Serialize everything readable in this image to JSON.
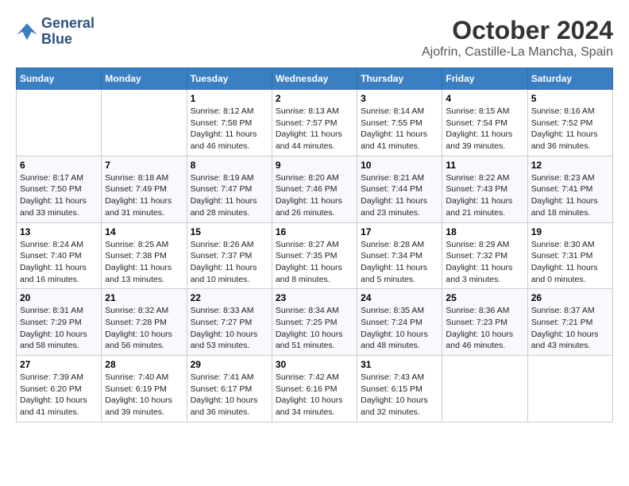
{
  "logo": {
    "line1": "General",
    "line2": "Blue"
  },
  "title": "October 2024",
  "location": "Ajofrin, Castille-La Mancha, Spain",
  "days_of_week": [
    "Sunday",
    "Monday",
    "Tuesday",
    "Wednesday",
    "Thursday",
    "Friday",
    "Saturday"
  ],
  "weeks": [
    [
      {
        "day": "",
        "info": ""
      },
      {
        "day": "",
        "info": ""
      },
      {
        "day": "1",
        "info": "Sunrise: 8:12 AM\nSunset: 7:58 PM\nDaylight: 11 hours and 46 minutes."
      },
      {
        "day": "2",
        "info": "Sunrise: 8:13 AM\nSunset: 7:57 PM\nDaylight: 11 hours and 44 minutes."
      },
      {
        "day": "3",
        "info": "Sunrise: 8:14 AM\nSunset: 7:55 PM\nDaylight: 11 hours and 41 minutes."
      },
      {
        "day": "4",
        "info": "Sunrise: 8:15 AM\nSunset: 7:54 PM\nDaylight: 11 hours and 39 minutes."
      },
      {
        "day": "5",
        "info": "Sunrise: 8:16 AM\nSunset: 7:52 PM\nDaylight: 11 hours and 36 minutes."
      }
    ],
    [
      {
        "day": "6",
        "info": "Sunrise: 8:17 AM\nSunset: 7:50 PM\nDaylight: 11 hours and 33 minutes."
      },
      {
        "day": "7",
        "info": "Sunrise: 8:18 AM\nSunset: 7:49 PM\nDaylight: 11 hours and 31 minutes."
      },
      {
        "day": "8",
        "info": "Sunrise: 8:19 AM\nSunset: 7:47 PM\nDaylight: 11 hours and 28 minutes."
      },
      {
        "day": "9",
        "info": "Sunrise: 8:20 AM\nSunset: 7:46 PM\nDaylight: 11 hours and 26 minutes."
      },
      {
        "day": "10",
        "info": "Sunrise: 8:21 AM\nSunset: 7:44 PM\nDaylight: 11 hours and 23 minutes."
      },
      {
        "day": "11",
        "info": "Sunrise: 8:22 AM\nSunset: 7:43 PM\nDaylight: 11 hours and 21 minutes."
      },
      {
        "day": "12",
        "info": "Sunrise: 8:23 AM\nSunset: 7:41 PM\nDaylight: 11 hours and 18 minutes."
      }
    ],
    [
      {
        "day": "13",
        "info": "Sunrise: 8:24 AM\nSunset: 7:40 PM\nDaylight: 11 hours and 16 minutes."
      },
      {
        "day": "14",
        "info": "Sunrise: 8:25 AM\nSunset: 7:38 PM\nDaylight: 11 hours and 13 minutes."
      },
      {
        "day": "15",
        "info": "Sunrise: 8:26 AM\nSunset: 7:37 PM\nDaylight: 11 hours and 10 minutes."
      },
      {
        "day": "16",
        "info": "Sunrise: 8:27 AM\nSunset: 7:35 PM\nDaylight: 11 hours and 8 minutes."
      },
      {
        "day": "17",
        "info": "Sunrise: 8:28 AM\nSunset: 7:34 PM\nDaylight: 11 hours and 5 minutes."
      },
      {
        "day": "18",
        "info": "Sunrise: 8:29 AM\nSunset: 7:32 PM\nDaylight: 11 hours and 3 minutes."
      },
      {
        "day": "19",
        "info": "Sunrise: 8:30 AM\nSunset: 7:31 PM\nDaylight: 11 hours and 0 minutes."
      }
    ],
    [
      {
        "day": "20",
        "info": "Sunrise: 8:31 AM\nSunset: 7:29 PM\nDaylight: 10 hours and 58 minutes."
      },
      {
        "day": "21",
        "info": "Sunrise: 8:32 AM\nSunset: 7:28 PM\nDaylight: 10 hours and 56 minutes."
      },
      {
        "day": "22",
        "info": "Sunrise: 8:33 AM\nSunset: 7:27 PM\nDaylight: 10 hours and 53 minutes."
      },
      {
        "day": "23",
        "info": "Sunrise: 8:34 AM\nSunset: 7:25 PM\nDaylight: 10 hours and 51 minutes."
      },
      {
        "day": "24",
        "info": "Sunrise: 8:35 AM\nSunset: 7:24 PM\nDaylight: 10 hours and 48 minutes."
      },
      {
        "day": "25",
        "info": "Sunrise: 8:36 AM\nSunset: 7:23 PM\nDaylight: 10 hours and 46 minutes."
      },
      {
        "day": "26",
        "info": "Sunrise: 8:37 AM\nSunset: 7:21 PM\nDaylight: 10 hours and 43 minutes."
      }
    ],
    [
      {
        "day": "27",
        "info": "Sunrise: 7:39 AM\nSunset: 6:20 PM\nDaylight: 10 hours and 41 minutes."
      },
      {
        "day": "28",
        "info": "Sunrise: 7:40 AM\nSunset: 6:19 PM\nDaylight: 10 hours and 39 minutes."
      },
      {
        "day": "29",
        "info": "Sunrise: 7:41 AM\nSunset: 6:17 PM\nDaylight: 10 hours and 36 minutes."
      },
      {
        "day": "30",
        "info": "Sunrise: 7:42 AM\nSunset: 6:16 PM\nDaylight: 10 hours and 34 minutes."
      },
      {
        "day": "31",
        "info": "Sunrise: 7:43 AM\nSunset: 6:15 PM\nDaylight: 10 hours and 32 minutes."
      },
      {
        "day": "",
        "info": ""
      },
      {
        "day": "",
        "info": ""
      }
    ]
  ]
}
